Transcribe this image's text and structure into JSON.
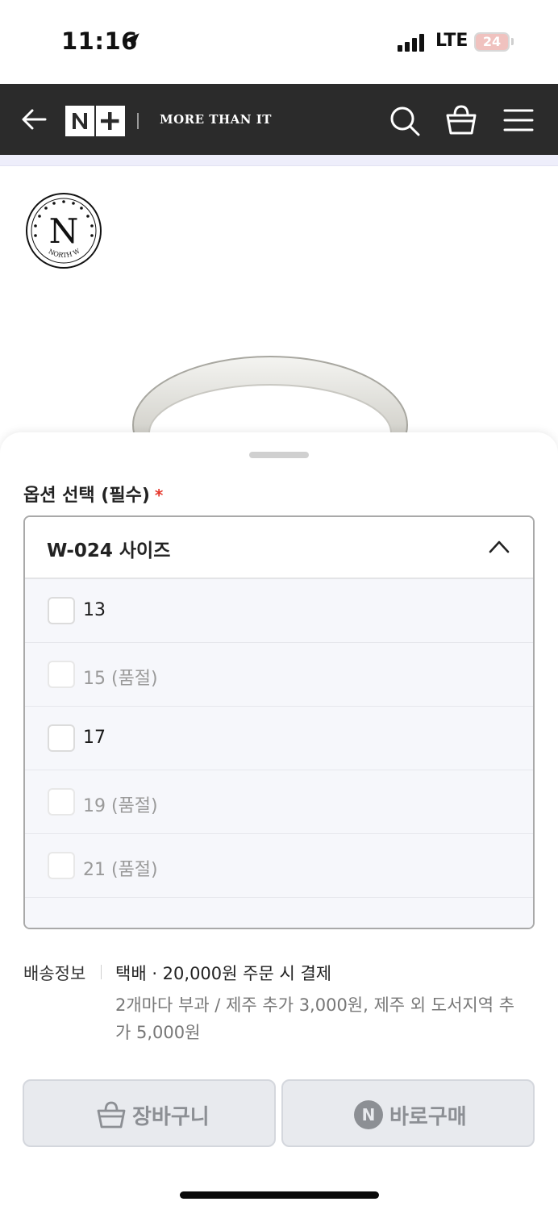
{
  "status_bar": {
    "time": "11:16",
    "network": "LTE",
    "battery": "24"
  },
  "header": {
    "brand_mark": "N+",
    "tagline": "MORE THAN IT"
  },
  "store": {
    "logo_letter": "N",
    "logo_ring_text": "NORTH WORKS"
  },
  "option_sheet": {
    "label": "옵션 선택 (필수)",
    "required_mark": "*",
    "selected_option": "W-024 사이즈",
    "options": [
      {
        "label": "13",
        "sold_out": false
      },
      {
        "label": "15 (품절)",
        "sold_out": true
      },
      {
        "label": "17",
        "sold_out": false
      },
      {
        "label": "19 (품절)",
        "sold_out": true
      },
      {
        "label": "21 (품절)",
        "sold_out": true
      }
    ]
  },
  "shipping": {
    "label": "배송정보",
    "main": "택배 · 20,000원 주문 시 결제",
    "note": "2개마다 부과 / 제주 추가 3,000원, 제주 외 도서지역 추가 5,000원"
  },
  "actions": {
    "cart_label": "장바구니",
    "buy_label": "바로구매",
    "buy_badge": "N"
  },
  "colors": {
    "navbar": "#2b2b2b",
    "sheet_list_bg": "#f6f7fb",
    "required": "#e5362b",
    "button_bg": "#e8eaee"
  }
}
